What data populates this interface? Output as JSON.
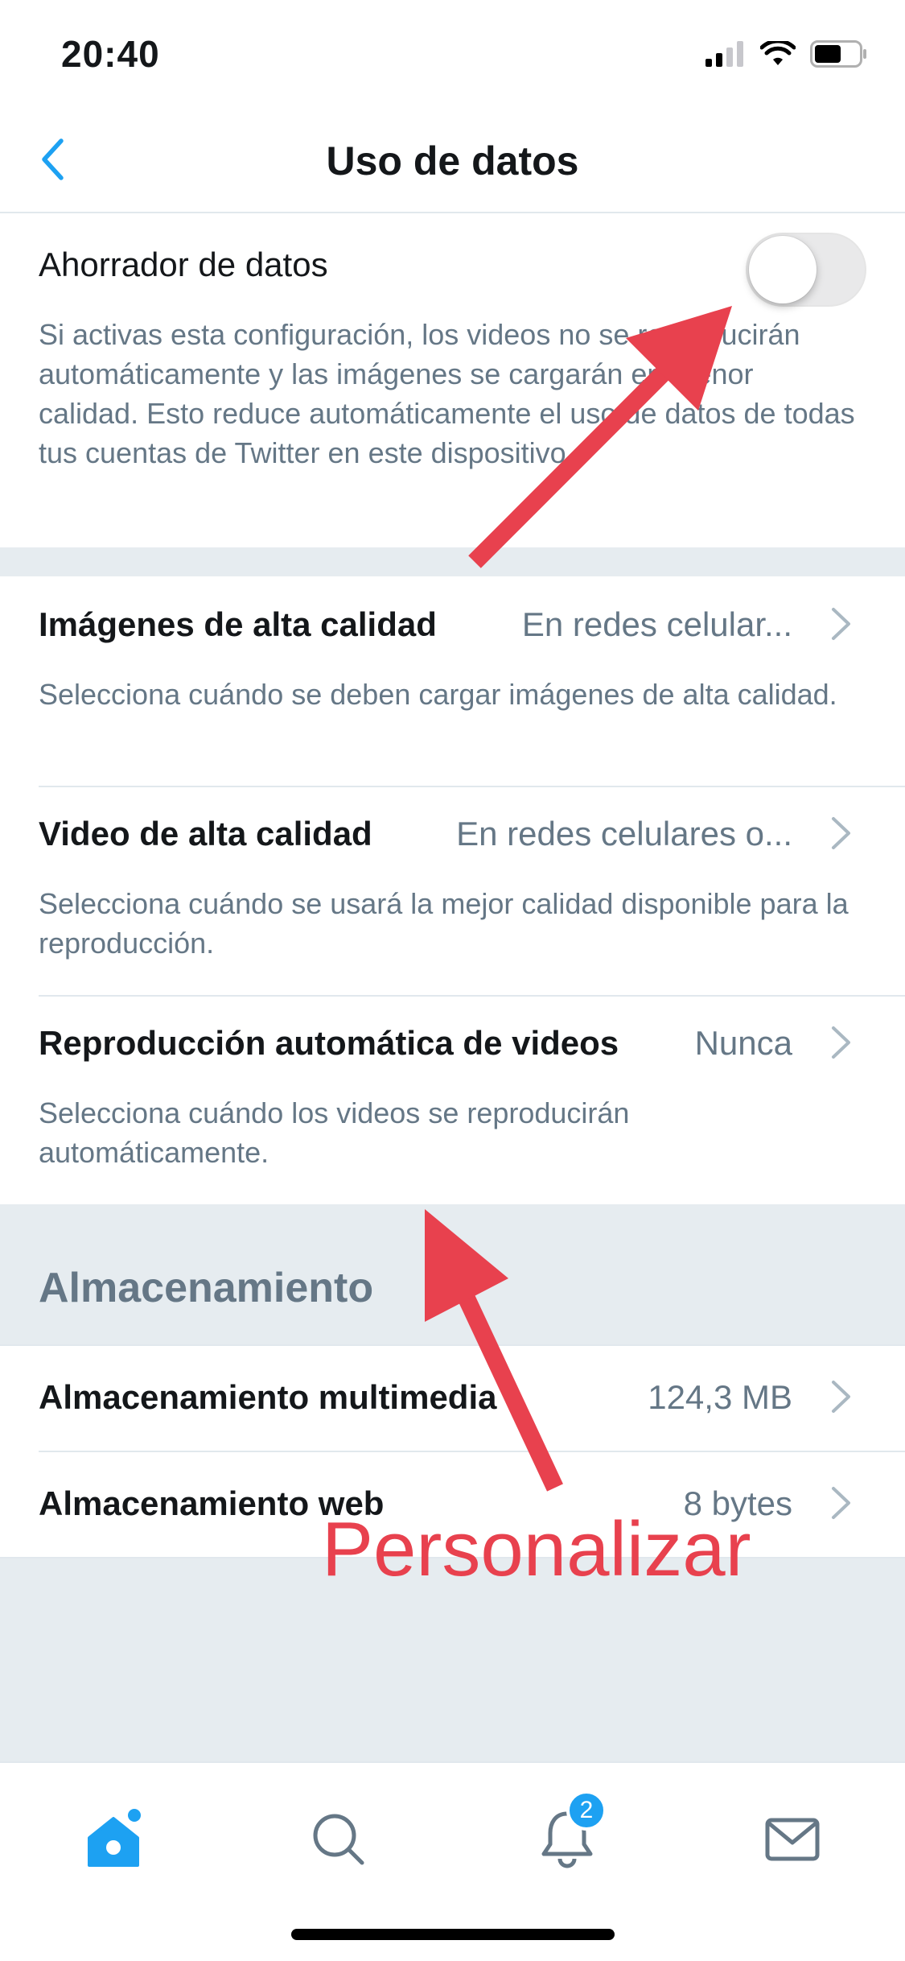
{
  "status_bar": {
    "time": "20:40"
  },
  "nav": {
    "title": "Uso de datos"
  },
  "data_saver": {
    "title": "Ahorrador de datos",
    "enabled": false,
    "description": "Si activas esta configuración, los videos no se reproducirán automáticamente y las imágenes se cargarán en menor calidad. Esto reduce automáticamente el uso de datos de todas tus cuentas de Twitter en este dispositivo."
  },
  "media_settings": [
    {
      "title": "Imágenes de alta calidad",
      "value": "En redes celular...",
      "description": "Selecciona cuándo se deben cargar imágenes de alta calidad."
    },
    {
      "title": "Video de alta calidad",
      "value": "En redes celulares o...",
      "description": "Selecciona cuándo se usará la mejor calidad disponible para la reproducción."
    },
    {
      "title": "Reproducción automática de videos",
      "value": "Nunca",
      "description": "Selecciona cuándo los videos se reproducirán automáticamente."
    }
  ],
  "storage": {
    "header": "Almacenamiento",
    "items": [
      {
        "title": "Almacenamiento multimedia",
        "value": "124,3 MB"
      },
      {
        "title": "Almacenamiento web",
        "value": "8 bytes"
      }
    ]
  },
  "annotation": {
    "text": "Personalizar",
    "color": "#e8414e"
  },
  "tab_bar": {
    "notifications_badge": "2"
  },
  "colors": {
    "accent": "#1da1f2",
    "secondary_text": "#657786",
    "band": "#e6ecf0"
  }
}
